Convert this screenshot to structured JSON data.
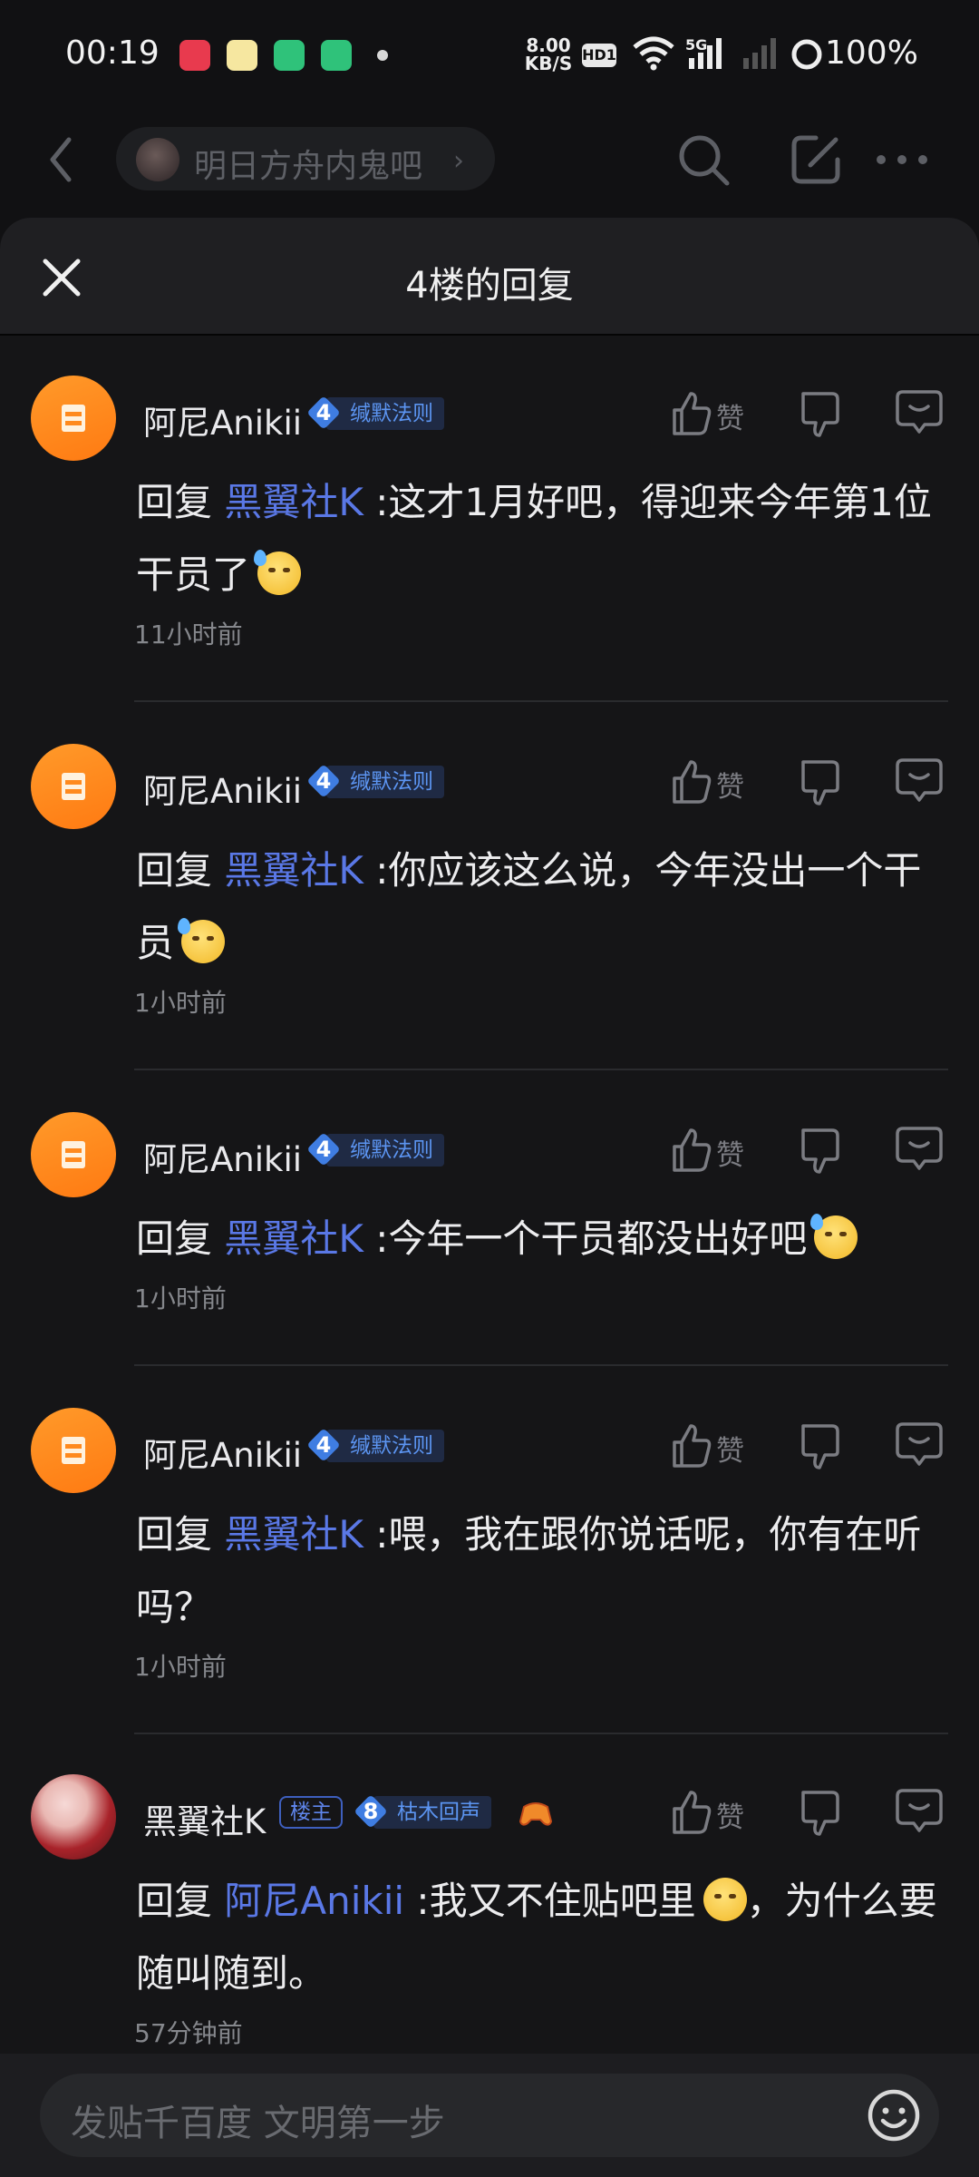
{
  "status_bar": {
    "time": "00:19",
    "net_speed_value": "8.00",
    "net_speed_unit": "KB/S",
    "hd_label": "HD1",
    "network": "5G",
    "battery": "100%"
  },
  "header": {
    "forum_name": "明日方舟内鬼吧",
    "forum_chevron": "›"
  },
  "sheet": {
    "title": "4楼的回复"
  },
  "replies": [
    {
      "username": "阿尼Anikii",
      "level": "4",
      "level_title": "缄默法则",
      "like_label": "赞",
      "reply_prefix": "回复",
      "mention": "黑翼社K",
      "text": " :这才1月好吧，得迎来今年第1位干员了",
      "time": "11小时前"
    },
    {
      "username": "阿尼Anikii",
      "level": "4",
      "level_title": "缄默法则",
      "like_label": "赞",
      "reply_prefix": "回复",
      "mention": "黑翼社K",
      "text": " :你应该这么说，今年没出一个干员",
      "time": "1小时前"
    },
    {
      "username": "阿尼Anikii",
      "level": "4",
      "level_title": "缄默法则",
      "like_label": "赞",
      "reply_prefix": "回复",
      "mention": "黑翼社K",
      "text": " :今年一个干员都没出好吧",
      "time": "1小时前"
    },
    {
      "username": "阿尼Anikii",
      "level": "4",
      "level_title": "缄默法则",
      "like_label": "赞",
      "reply_prefix": "回复",
      "mention": "黑翼社K",
      "text": " :喂，我在跟你说话呢，你有在听吗？",
      "time": "1小时前"
    },
    {
      "username": "黑翼社K",
      "owner_tag": "楼主",
      "level": "8",
      "level_title": "枯木回声",
      "like_label": "赞",
      "reply_prefix": "回复",
      "mention": "阿尼Anikii",
      "text": " :我又不住贴吧里",
      "text_after_emoji": "，为什么要随叫随到。",
      "time": "57分钟前"
    }
  ],
  "composer": {
    "placeholder": "发贴千百度 文明第一步"
  },
  "colors": {
    "background": "#111113",
    "mention": "#5a78e6",
    "level_badge": "#3f7de2",
    "avatar_orange": "#ff8a1e"
  }
}
